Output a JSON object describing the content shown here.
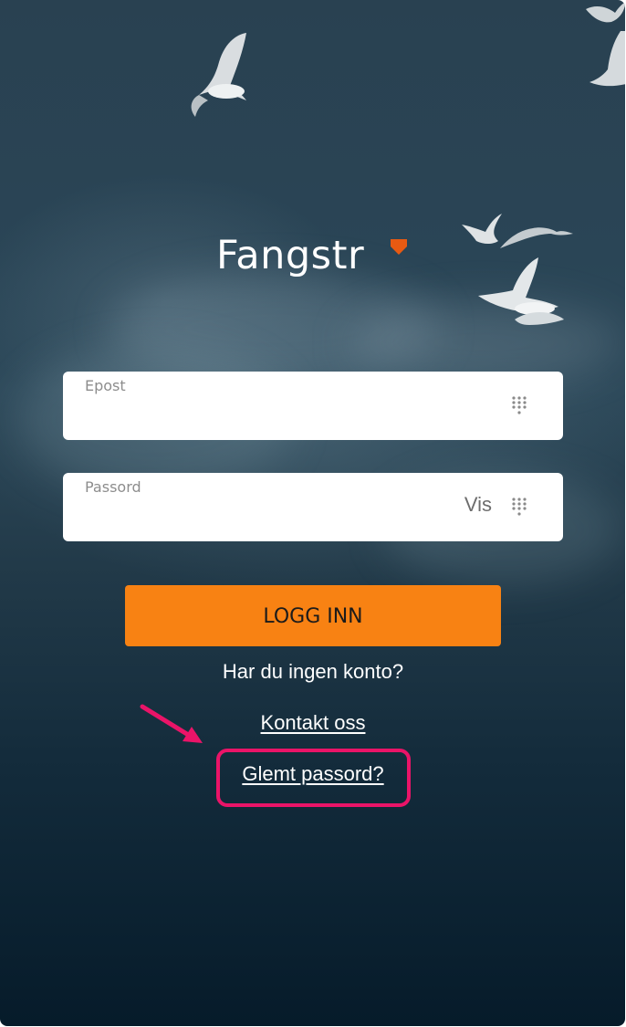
{
  "brand": {
    "name": "Fangstr",
    "accent_color": "#e85a12"
  },
  "email_field": {
    "label": "Epost",
    "value": "",
    "icon": "keypad-icon"
  },
  "password_field": {
    "label": "Passord",
    "value": "",
    "show_toggle_label": "Vis",
    "icon": "keypad-icon"
  },
  "login_button": {
    "label": "LOGG INN",
    "color": "#f88213"
  },
  "signup_prompt": "Har du ingen konto?",
  "contact_link": "Kontakt oss",
  "forgot_password_link": "Glemt passord?",
  "annotation": {
    "color": "#ea1468",
    "icon": "arrow-icon"
  }
}
